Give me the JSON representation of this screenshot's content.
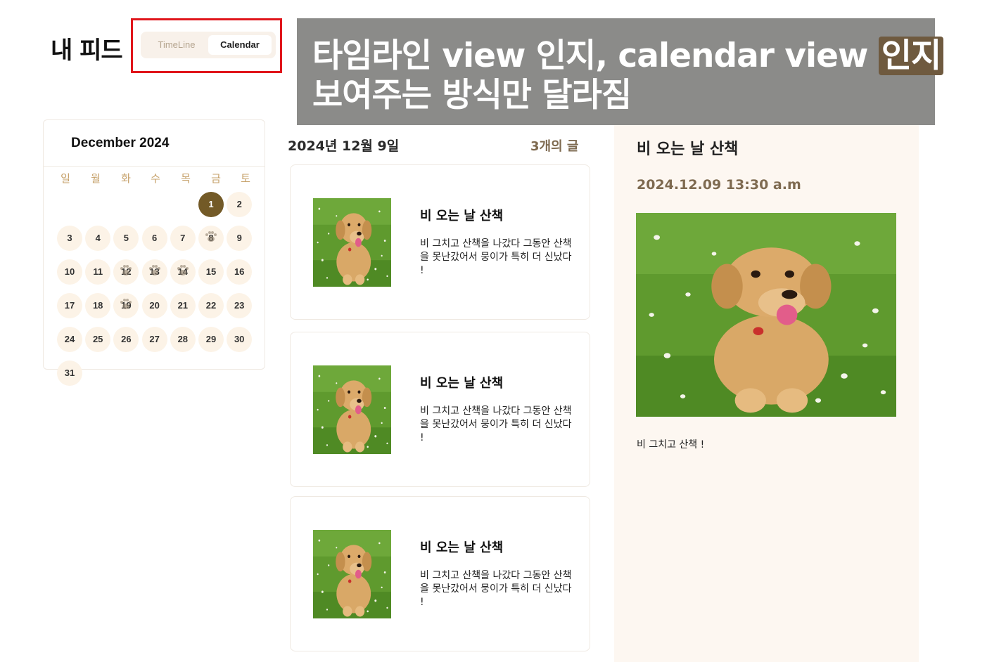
{
  "header": {
    "page_title": "내 피드",
    "view_toggle": {
      "timeline_label": "TimeLine",
      "calendar_label": "Calendar",
      "selected": "Calendar"
    }
  },
  "annotation": {
    "line1_before": "타임라인 view 인지, calendar view ",
    "line1_highlight": "인지",
    "line2": "보여주는 방식만 달라짐",
    "highlight_color": "#e0151b"
  },
  "calendar": {
    "month_label": "December 2024",
    "weekdays": [
      "일",
      "월",
      "화",
      "수",
      "목",
      "금",
      "토"
    ],
    "selected_day": "1",
    "days": [
      {
        "label": "1",
        "selected": true,
        "paw": false
      },
      {
        "label": "2",
        "paw": false
      },
      {
        "label": "3",
        "paw": false
      },
      {
        "label": "4",
        "paw": false
      },
      {
        "label": "5",
        "paw": false
      },
      {
        "label": "6",
        "paw": false
      },
      {
        "label": "7",
        "paw": false
      },
      {
        "label": "8",
        "paw": true
      },
      {
        "label": "9",
        "paw": false
      },
      {
        "label": "10",
        "paw": false
      },
      {
        "label": "11",
        "paw": false
      },
      {
        "label": "12",
        "paw": true
      },
      {
        "label": "13",
        "paw": true
      },
      {
        "label": "14",
        "paw": true
      },
      {
        "label": "15",
        "paw": false
      },
      {
        "label": "16",
        "paw": false
      },
      {
        "label": "17",
        "paw": false
      },
      {
        "label": "18",
        "paw": false
      },
      {
        "label": "19",
        "paw": true
      },
      {
        "label": "20",
        "paw": false
      },
      {
        "label": "21",
        "paw": false
      },
      {
        "label": "22",
        "paw": false
      },
      {
        "label": "23",
        "paw": false
      },
      {
        "label": "24",
        "paw": false
      },
      {
        "label": "25",
        "paw": false
      },
      {
        "label": "26",
        "paw": false
      },
      {
        "label": "27",
        "paw": false
      },
      {
        "label": "28",
        "paw": false
      },
      {
        "label": "29",
        "paw": false
      },
      {
        "label": "30",
        "paw": false
      },
      {
        "label": "31",
        "paw": false
      }
    ],
    "first_weekday_index": 5,
    "accent_color": "#735a27"
  },
  "feed": {
    "date_label": "2024년 12월 9일",
    "count_label": "3개의 글",
    "posts": [
      {
        "title": "비 오는 날 산책",
        "body": "비 그치고 산책을 나갔다 그동안 산책을 못난갔어서 뭉이가 특히 더 신났다 !",
        "image": "dog-photo"
      },
      {
        "title": "비 오는 날 산책",
        "body": "비 그치고 산책을 나갔다 그동안 산책을 못난갔어서 뭉이가 특히 더 신났다 !",
        "image": "dog-photo"
      },
      {
        "title": "비 오는 날 산책",
        "body": "비 그치고 산책을 나갔다 그동안 산책을 못난갔어서 뭉이가 특히 더 신났다 !",
        "image": "dog-photo"
      }
    ]
  },
  "detail": {
    "title": "비 오는 날 산책",
    "timestamp": "2024.12.09 13:30 a.m",
    "body": "비 그치고 산책 !",
    "image": "dog-photo"
  }
}
